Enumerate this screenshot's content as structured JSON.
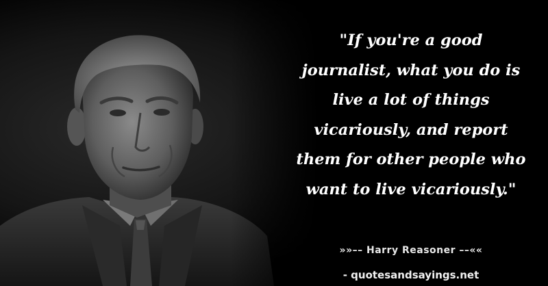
{
  "quote": {
    "lines": [
      "\"If you're a good",
      "journalist, what you do is",
      "live a lot of things",
      "vicariously, and report",
      "them for other people who",
      "want to live vicariously.\""
    ]
  },
  "author_line": "»»–– Harry Reasoner ––««",
  "source_line": "- quotesandsayings.net",
  "colors": {
    "background": "#000000",
    "text": "#ffffff"
  }
}
